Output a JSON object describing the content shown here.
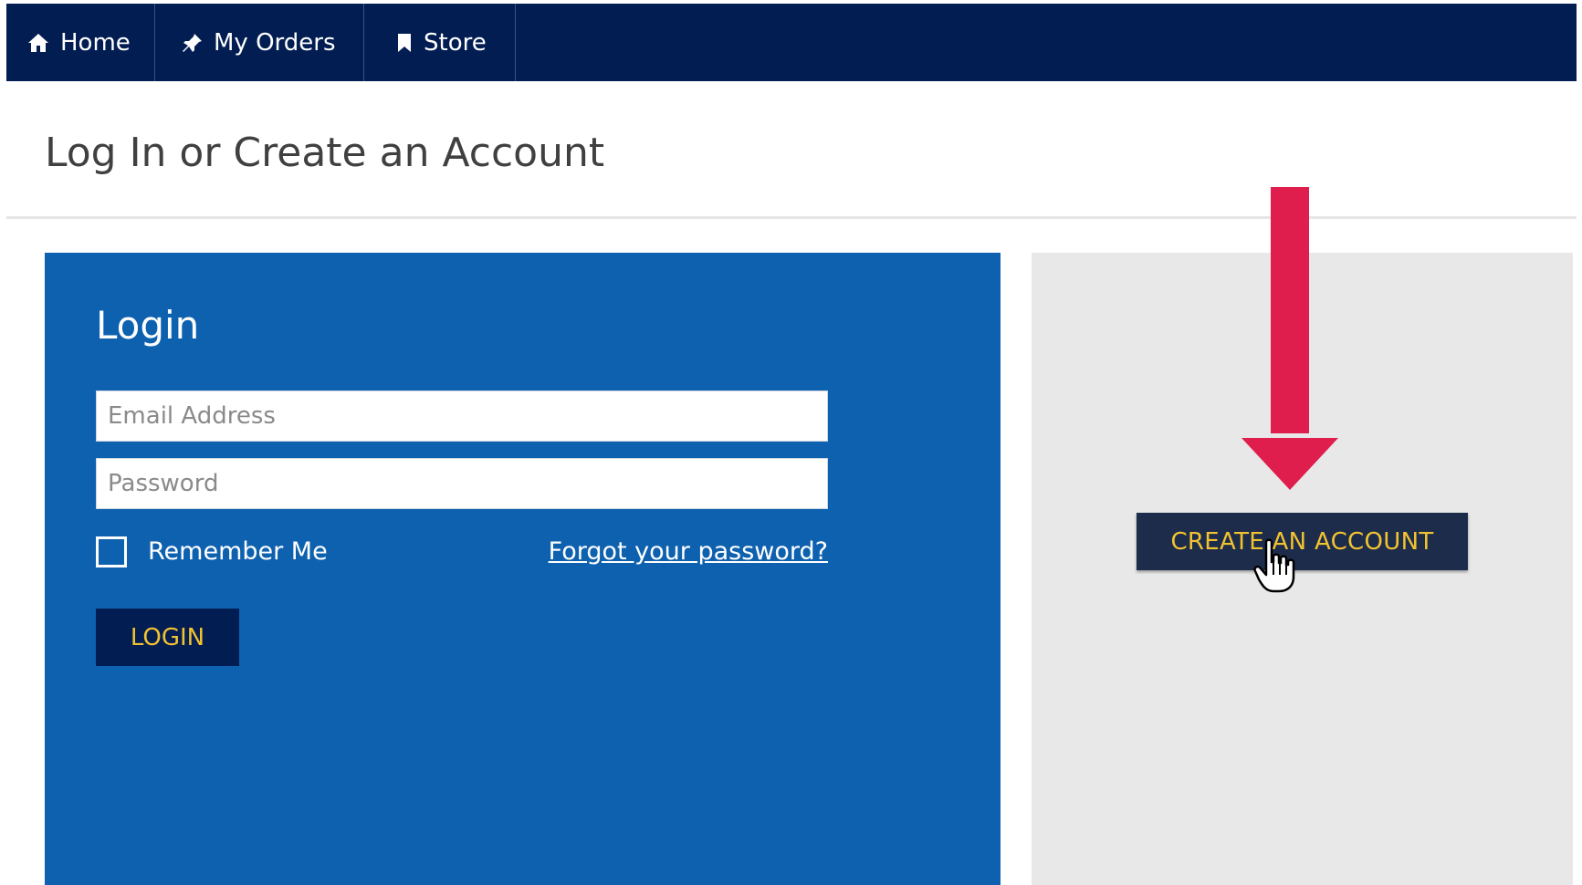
{
  "nav": {
    "items": [
      {
        "label": "Home",
        "icon": "home-icon"
      },
      {
        "label": "My Orders",
        "icon": "pin-icon"
      },
      {
        "label": "Store",
        "icon": "bookmark-icon"
      }
    ]
  },
  "page": {
    "title": "Log In or Create an Account"
  },
  "login": {
    "heading": "Login",
    "email_placeholder": "Email Address",
    "password_placeholder": "Password",
    "remember_label": "Remember Me",
    "forgot_link": "Forgot your password?",
    "button_label": "LOGIN"
  },
  "create": {
    "button_label": "CREATE AN ACCOUNT"
  },
  "colors": {
    "navbar": "#021d52",
    "login_panel": "#0e61af",
    "create_panel": "#e8e8e8",
    "button_text": "#f2c230",
    "arrow": "#e01e4e"
  }
}
